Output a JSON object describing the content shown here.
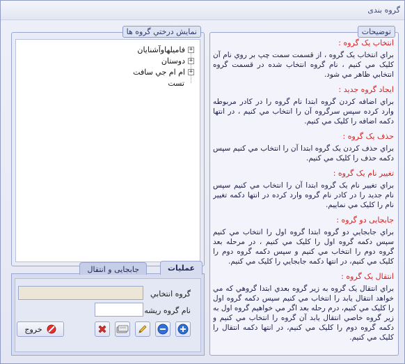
{
  "window": {
    "title": "گروه بندی"
  },
  "descriptions": {
    "legend": "توضیحات",
    "items": [
      {
        "heading": "انتخاب یک گروه :",
        "text": "براي انتخاب يک گروه ، از قسمت سمت چپ بر روي نام آن کليک مي کنيم ، نام گروه انتخاب شده در قسمت گروه انتخابي ظاهر مي شود."
      },
      {
        "heading": "ایجاد گروه جدید :",
        "text": "براي اضافه کردن گروه ابتدا نام گروه را در کادر مربوطه وارد کرده سپس سرگروه آن را انتخاب مي کنيم ، در انتها دکمه اضافه را کليک مي کنيم."
      },
      {
        "heading": "حذف یک گروه :",
        "text": "براي حذف کردن يک گروه ابتدا آن را انتخاب مي کنيم سپس دکمه حذف را کليک مي کنيم."
      },
      {
        "heading": "تغییر نام یک گروه :",
        "text": "براي تغيير نام يک گروه ابتدا آن را انتخاب مي کنيم سپس نام جديد را در کادر نام گروه وارد کرده در انتها دکمه تغيير نام را کليک مي نماييم."
      },
      {
        "heading": "جابجایی دو گروه :",
        "text": "براي جابجايي دو گروه ابتدا گروه اول را انتخاب مي کنيم سپس دکمه گروه اول را کليک مي کنيم ، در مرحله بعد گروه دوم را انتخاب مي کنيم و سپس دکمه گروه دوم را کليک مي کنيم، در انتها دکمه جابجايي را کليک مي کنيم."
      },
      {
        "heading": "انتقال یک گروه :",
        "text": "براي انتقال يک گروه به زير گروه بعدي ابتدا گروهي که مي خواهد انتقال يابد را انتخاب مي کنيم سپس دکمه گروه اول را کليک مي کنيم، درم رحله بعد اگر مي خواهيم گروه اول به زير گروه خاصي انتقال يابد آن گروه را انتخاب مي کنيم و دکمه گروه دوم را کليک مي کنيم، در انتها دکمه انتقال را کليک مي کنيم."
      }
    ]
  },
  "tree": {
    "legend": "نمايش درختي گروه ها",
    "nodes": [
      {
        "label": "فامیلهاوآشنایان",
        "expander": "+"
      },
      {
        "label": "دوستان",
        "expander": "+"
      },
      {
        "label": "ام ام جي سافت",
        "expander": "+"
      },
      {
        "label": "تست",
        "expander": ""
      }
    ]
  },
  "operations": {
    "tabs": [
      {
        "label": "عملیات",
        "active": true
      },
      {
        "label": "جابجایی و انتقال",
        "active": false
      }
    ],
    "selected_group_label": "گروه انتخابي",
    "selected_group_value": "",
    "root_group_label": "نام گروه ريشه",
    "root_group_value": "",
    "exit_label": "خروج",
    "icons": [
      "add-icon",
      "remove-icon",
      "edit-icon",
      "move-icon",
      "delete-icon",
      "exit-icon"
    ]
  },
  "colors": {
    "heading": "#d62222",
    "add": "#2f6fd6",
    "remove": "#2f6fd6",
    "delete": "#d63030"
  }
}
